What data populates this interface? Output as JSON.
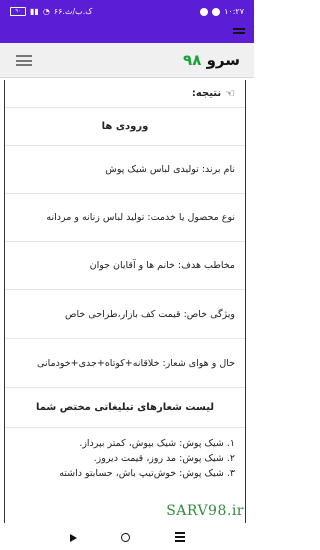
{
  "statusbar": {
    "time": "۱۰:۲۷",
    "speed": "۶۶.ک.ب/ث",
    "battery": "۹۰"
  },
  "site": {
    "logo_text": "سرو",
    "logo_number": "۹۸"
  },
  "content": {
    "result_label": "نتیجه:",
    "inputs_heading": "ورودی ها",
    "rows": [
      "نام برند: تولیدی لباس شیک پوش",
      "نوع محصول یا خدمت: تولید لباس زنانه و مردانه",
      "مخاطب هدف: خانم ها و آقایان جوان",
      "ویژگی خاص: قیمت کف بازار،طراحی خاص",
      "حال و هوای شعار: خلاقانه+کوتاه+جدی+خودمانی"
    ],
    "slogans_heading": "لیست شعارهای تبلیغاتی مختص شما",
    "slogans": [
      "۱. شیک پوش: شیک بپوش، کمتر بپرداز.",
      "۲. شیک پوش: مد روز، قیمت دیروز.",
      "۳. شیک پوش: خوش‌تیپ باش، حسابتو داشته"
    ]
  },
  "watermark": "SARV98.ir"
}
